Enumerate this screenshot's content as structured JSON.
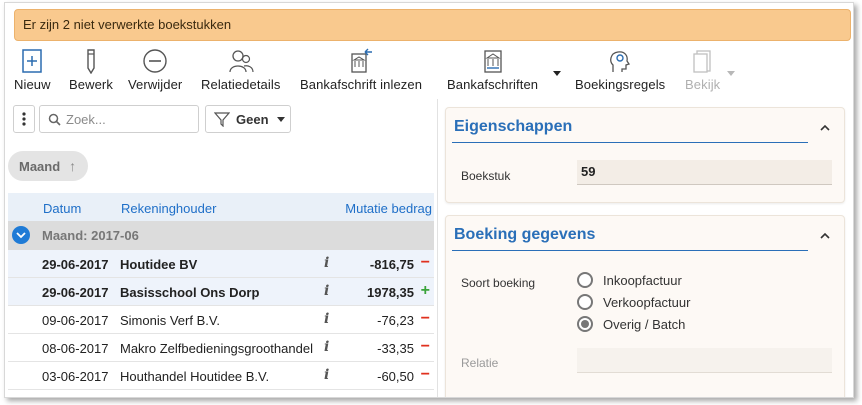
{
  "banner": {
    "message": "Er zijn 2 niet verwerkte boekstukken"
  },
  "toolbar": {
    "new_label": "Nieuw",
    "edit_label": "Bewerk",
    "delete_label": "Verwijder",
    "relation_label": "Relatiedetails",
    "import_label": "Bankafschrift inlezen",
    "statements_label": "Bankafschriften",
    "rules_label": "Boekingsregels",
    "view_label": "Bekijk"
  },
  "list": {
    "search_placeholder": "Zoek...",
    "filter_label": "Geen",
    "group_chip": "Maand",
    "group_chip_arrow": "↑",
    "columns": {
      "date": "Datum",
      "holder": "Rekeninghouder",
      "amount": "Mutatie bedrag"
    },
    "group_row": "Maand: 2017-06",
    "info_glyph": "i",
    "rows": [
      {
        "date": "29-06-2017",
        "holder": "Houtidee BV",
        "amount": "-816,75",
        "sign": "−",
        "unprocessed": true
      },
      {
        "date": "29-06-2017",
        "holder": "Basisschool Ons Dorp",
        "amount": "1978,35",
        "sign": "+",
        "unprocessed": true
      },
      {
        "date": "09-06-2017",
        "holder": "Simonis Verf B.V.",
        "amount": "-76,23",
        "sign": "−",
        "unprocessed": false
      },
      {
        "date": "08-06-2017",
        "holder": "Makro Zelfbedieningsgroothandel",
        "amount": "-33,35",
        "sign": "−",
        "unprocessed": false
      },
      {
        "date": "03-06-2017",
        "holder": "Houthandel Houtidee B.V.",
        "amount": "-60,50",
        "sign": "−",
        "unprocessed": false
      }
    ]
  },
  "properties": {
    "title": "Eigenschappen",
    "document_label": "Boekstuk",
    "document_value": "59"
  },
  "booking": {
    "title": "Boeking gegevens",
    "type_label": "Soort boeking",
    "options": [
      {
        "label": "Inkoopfactuur",
        "selected": false
      },
      {
        "label": "Verkoopfactuur",
        "selected": false
      },
      {
        "label": "Overig / Batch",
        "selected": true
      }
    ],
    "relation_label": "Relatie"
  },
  "colors": {
    "accent": "#1f6fc8",
    "banner": "#f9c98e",
    "negative": "#e0301e",
    "positive": "#3aa33a"
  }
}
